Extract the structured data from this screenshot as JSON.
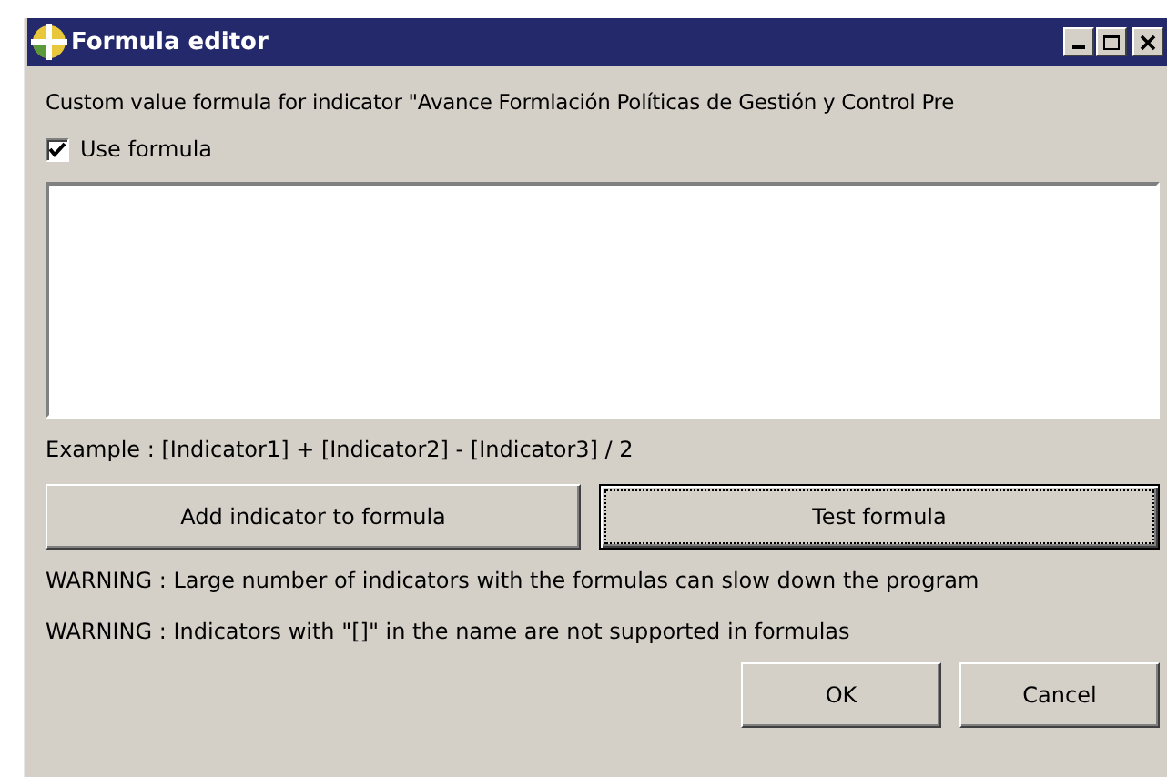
{
  "window": {
    "title": "Formula editor"
  },
  "description": "Custom value formula for indicator \"Avance Formlación Políticas de Gestión y Control Pre",
  "use_formula": {
    "label": "Use formula",
    "checked": true
  },
  "example": "Example : [Indicator1] + [Indicator2] - [Indicator3] / 2",
  "action_buttons": [
    {
      "label": "Add indicator to formula",
      "focused": false
    },
    {
      "label": "Test formula",
      "focused": true
    }
  ],
  "warnings": [
    "WARNING : Large number of indicators with the formulas can slow down the program",
    "WARNING : Indicators with \"[]\" in the name are not supported in formulas"
  ],
  "dialog_buttons": [
    "OK",
    "Cancel"
  ]
}
